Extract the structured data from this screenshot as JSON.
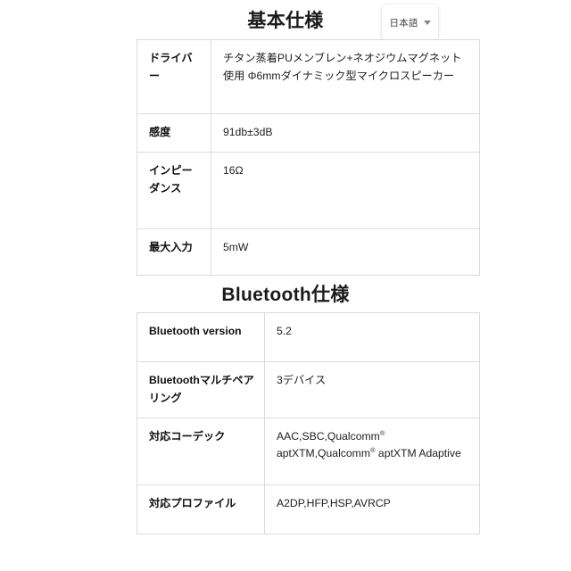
{
  "language_selector": {
    "label": "日本語",
    "icon": "chevron-down-icon"
  },
  "sections": [
    {
      "id": "basic",
      "title": "基本仕様",
      "rows": [
        {
          "key": "ドライバー",
          "value": "チタン蒸着PUメンブレン+ネオジウムマグネット使用 Φ6mmダイナミック型マイクロスピーカー"
        },
        {
          "key": "感度",
          "value": "91db±3dB"
        },
        {
          "key": "インピーダンス",
          "value": "16Ω"
        },
        {
          "key": "最大入力",
          "value": "5mW"
        }
      ]
    },
    {
      "id": "bluetooth",
      "title": "Bluetooth仕様",
      "rows": [
        {
          "key": "Bluetooth version",
          "value": "5.2"
        },
        {
          "key": "Bluetoothマルチペアリング",
          "value": "3デバイス"
        },
        {
          "key": "対応コーデック",
          "value_parts": [
            "AAC,SBC,Qualcomm",
            "®",
            " aptXTM,Qualcomm",
            "®",
            " aptXTM Adaptive"
          ]
        },
        {
          "key": "対応プロファイル",
          "value": "A2DP,HFP,HSP,AVRCP"
        }
      ]
    }
  ],
  "colors": {
    "background": "#ffffff",
    "text": "#202124",
    "heading": "#1a1a1a",
    "table_border": "#dcdcdc",
    "caret": "#80868b"
  }
}
